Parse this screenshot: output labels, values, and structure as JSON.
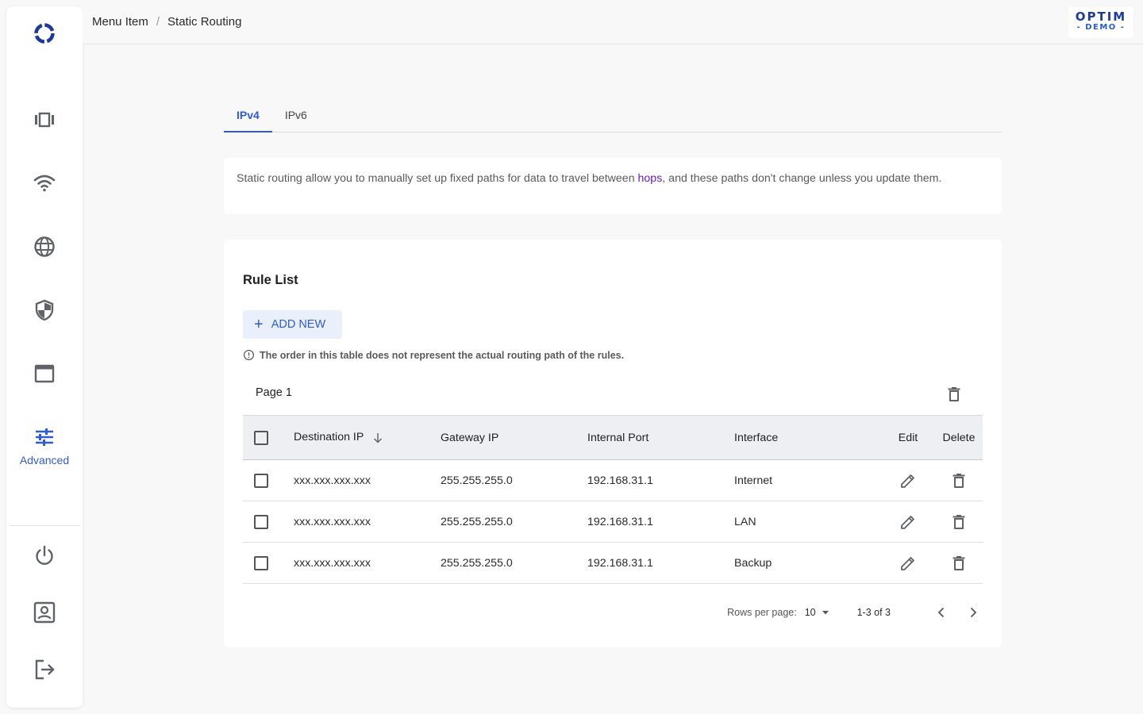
{
  "colors": {
    "accent": "#2f5bd8",
    "link": "#6a1bd1",
    "brand": "#1d3a9f"
  },
  "sidebar": {
    "logo_icon": "ring-logo-icon",
    "items": [
      {
        "icon": "devices-icon",
        "label": ""
      },
      {
        "icon": "wifi-icon",
        "label": ""
      },
      {
        "icon": "globe-icon",
        "label": ""
      },
      {
        "icon": "shield-icon",
        "label": ""
      },
      {
        "icon": "window-icon",
        "label": ""
      },
      {
        "icon": "sliders-icon",
        "label": "Advanced",
        "active": true
      }
    ],
    "bottom": [
      {
        "icon": "power-icon"
      },
      {
        "icon": "account-icon"
      },
      {
        "icon": "logout-icon"
      }
    ]
  },
  "header": {
    "breadcrumb": [
      "Menu Item",
      "Static Routing"
    ],
    "brand_top": "OPTIM",
    "brand_bottom": "- DEMO -"
  },
  "tabs": [
    {
      "label": "IPv4",
      "active": true
    },
    {
      "label": "IPv6",
      "active": false
    }
  ],
  "info": {
    "text_before": "Static routing allow you to manually set up fixed paths for data to travel between ",
    "link": "hops",
    "text_after": ", and these paths don't change unless you update them."
  },
  "rules": {
    "title": "Rule List",
    "add_label": "ADD NEW",
    "note": "The order in this table does not represent the actual routing path of the rules.",
    "page_label": "Page 1",
    "columns": {
      "destination": "Destination IP",
      "gateway": "Gateway IP",
      "port": "Internal Port",
      "interface": "Interface",
      "edit": "Edit",
      "delete": "Delete"
    },
    "rows": [
      {
        "destination": "xxx.xxx.xxx.xxx",
        "gateway": "255.255.255.0",
        "port": "192.168.31.1",
        "interface": "Internet"
      },
      {
        "destination": "xxx.xxx.xxx.xxx",
        "gateway": "255.255.255.0",
        "port": "192.168.31.1",
        "interface": "LAN"
      },
      {
        "destination": "xxx.xxx.xxx.xxx",
        "gateway": "255.255.255.0",
        "port": "192.168.31.1",
        "interface": "Backup"
      }
    ],
    "pagination": {
      "rows_label": "Rows per page:",
      "rows_value": "10",
      "range": "1-3 of 3"
    }
  }
}
